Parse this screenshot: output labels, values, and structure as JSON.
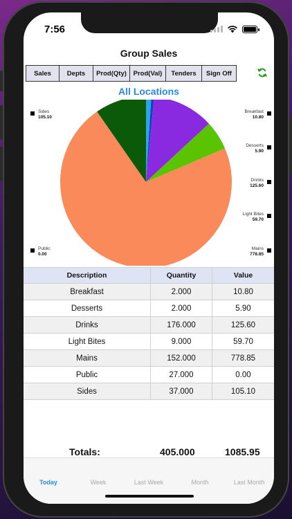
{
  "status_bar": {
    "time": "7:56"
  },
  "header": {
    "title": "Group Sales"
  },
  "toolbar": {
    "buttons": [
      {
        "label": "Sales"
      },
      {
        "label": "Depts"
      },
      {
        "label": "Prod(Qty)"
      },
      {
        "label": "Prod(Val)"
      },
      {
        "label": "Tenders"
      },
      {
        "label": "Sign Off"
      }
    ],
    "refresh_icon": "refresh-icon",
    "refresh_color": "#2a9a2a"
  },
  "subtitle": "All Locations",
  "chart_data": {
    "type": "pie",
    "title": "",
    "slices": [
      {
        "label": "Breakfast",
        "value": 10.8,
        "color": "#29a8e0"
      },
      {
        "label": "Desserts",
        "value": 5.9,
        "color": "#1a3ad0"
      },
      {
        "label": "Drinks",
        "value": 125.6,
        "color": "#8a2ae0"
      },
      {
        "label": "Light Bites",
        "value": 59.7,
        "color": "#5ac400"
      },
      {
        "label": "Mains",
        "value": 778.85,
        "color": "#fa8a5a"
      },
      {
        "label": "Public",
        "value": 0.0,
        "color": "#aaaaaa"
      },
      {
        "label": "Sides",
        "value": 105.1,
        "color": "#0a5a0a"
      }
    ],
    "legend": {
      "left": [
        {
          "label": "Sides",
          "value": "105.10"
        },
        {
          "label": "Public",
          "value": "0.00"
        }
      ],
      "right": [
        {
          "label": "Breakfast",
          "value": "10.80"
        },
        {
          "label": "Desserts",
          "value": "5.90"
        },
        {
          "label": "Drinks",
          "value": "125.60"
        },
        {
          "label": "Light Bites",
          "value": "59.70"
        },
        {
          "label": "Mains",
          "value": "778.85"
        }
      ]
    }
  },
  "table": {
    "headers": [
      "Description",
      "Quantity",
      "Value"
    ],
    "rows": [
      [
        "Breakfast",
        "2.000",
        "10.80"
      ],
      [
        "Desserts",
        "2.000",
        "5.90"
      ],
      [
        "Drinks",
        "176.000",
        "125.60"
      ],
      [
        "Light Bites",
        "9.000",
        "59.70"
      ],
      [
        "Mains",
        "152.000",
        "778.85"
      ],
      [
        "Public",
        "27.000",
        "0.00"
      ],
      [
        "Sides",
        "37.000",
        "105.10"
      ]
    ]
  },
  "totals": {
    "label": "Totals:",
    "quantity": "405.000",
    "value": "1085.95"
  },
  "tabs": [
    {
      "label": "Today",
      "active": true
    },
    {
      "label": "Week",
      "active": false
    },
    {
      "label": "Last Week",
      "active": false
    },
    {
      "label": "Month",
      "active": false
    },
    {
      "label": "Last Month",
      "active": false
    }
  ],
  "colors": {
    "accent": "#2a8ae0",
    "header_bg": "#dfe4f4"
  }
}
